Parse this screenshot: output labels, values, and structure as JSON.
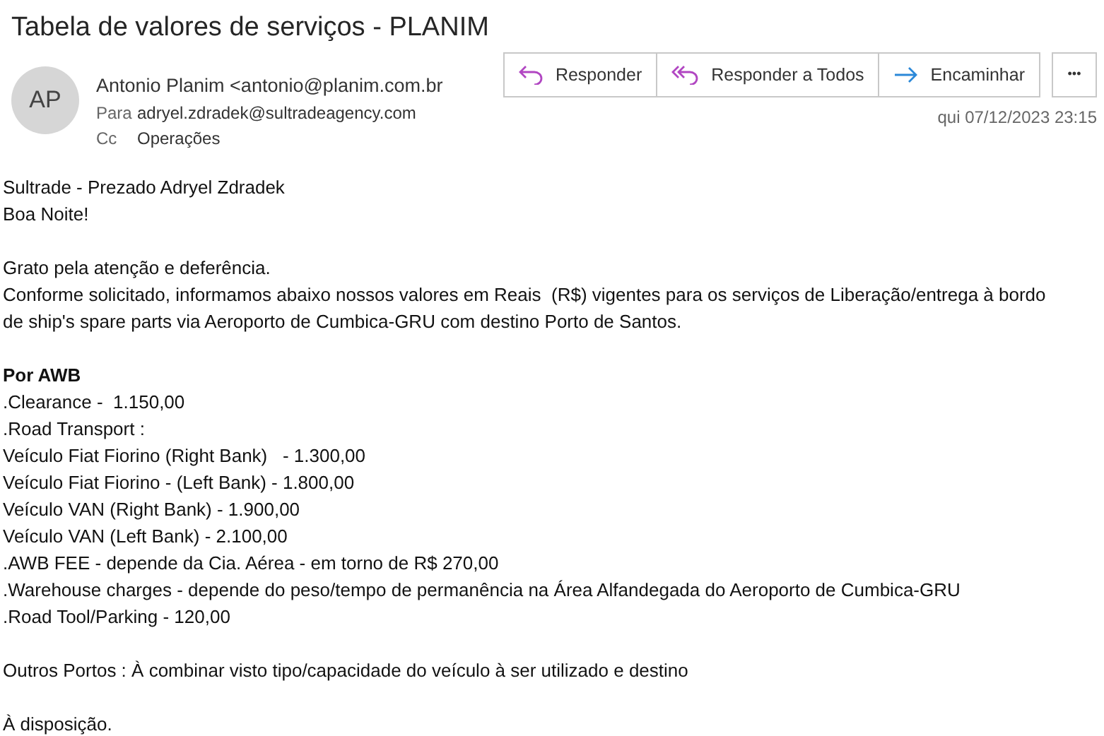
{
  "subject": "Tabela de valores de serviços - PLANIM",
  "avatar": "AP",
  "sender": "Antonio Planim <antonio@planim.com.br",
  "recipients": [
    {
      "label": "Para",
      "value": "adryel.zdradek@sultradeagency.com"
    },
    {
      "label": "Cc",
      "value": "Operações"
    }
  ],
  "actions": [
    {
      "kind": "reply",
      "label": "Responder"
    },
    {
      "kind": "reply_all",
      "label": "Responder a Todos"
    },
    {
      "kind": "forward",
      "label": "Encaminhar"
    }
  ],
  "more": "•••",
  "date": "qui 07/12/2023 23:15",
  "body": [
    {
      "lines": [
        {
          "text": "Sultrade - Prezado Adryel Zdradek",
          "bold": false
        },
        {
          "text": "Boa Noite!",
          "bold": false
        }
      ]
    },
    {
      "lines": [
        {
          "text": "Grato pela atenção e deferência.",
          "bold": false
        },
        {
          "text": "Conforme solicitado, informamos abaixo nossos valores em Reais  (R$) vigentes para os serviços de Liberação/entrega à bordo",
          "bold": false
        },
        {
          "text": "de ship's spare parts via Aeroporto de Cumbica-GRU com destino Porto de Santos.",
          "bold": false
        }
      ]
    },
    {
      "lines": [
        {
          "text": "Por AWB",
          "bold": true
        },
        {
          "text": ".Clearance -  1.150,00",
          "bold": false
        },
        {
          "text": ".Road Transport :",
          "bold": false
        },
        {
          "text": "Veículo Fiat Fiorino (Right Bank)   - 1.300,00",
          "bold": false
        },
        {
          "text": "Veículo Fiat Fiorino - (Left Bank) - 1.800,00",
          "bold": false
        },
        {
          "text": "Veículo VAN (Right Bank) - 1.900,00",
          "bold": false
        },
        {
          "text": "Veículo VAN (Left Bank) - 2.100,00",
          "bold": false
        },
        {
          "text": ".AWB FEE - depende da Cia. Aérea - em torno de R$ 270,00",
          "bold": false
        },
        {
          "text": ".Warehouse charges - depende do peso/tempo de permanência na Área Alfandegada do Aeroporto de Cumbica-GRU",
          "bold": false
        },
        {
          "text": ".Road Tool/Parking - 120,00",
          "bold": false
        }
      ]
    },
    {
      "lines": [
        {
          "text": "Outros Portos : À combinar visto tipo/capacidade do veículo à ser utilizado e destino",
          "bold": false
        }
      ]
    },
    {
      "lines": [
        {
          "text": "À disposição.",
          "bold": false
        }
      ]
    }
  ]
}
